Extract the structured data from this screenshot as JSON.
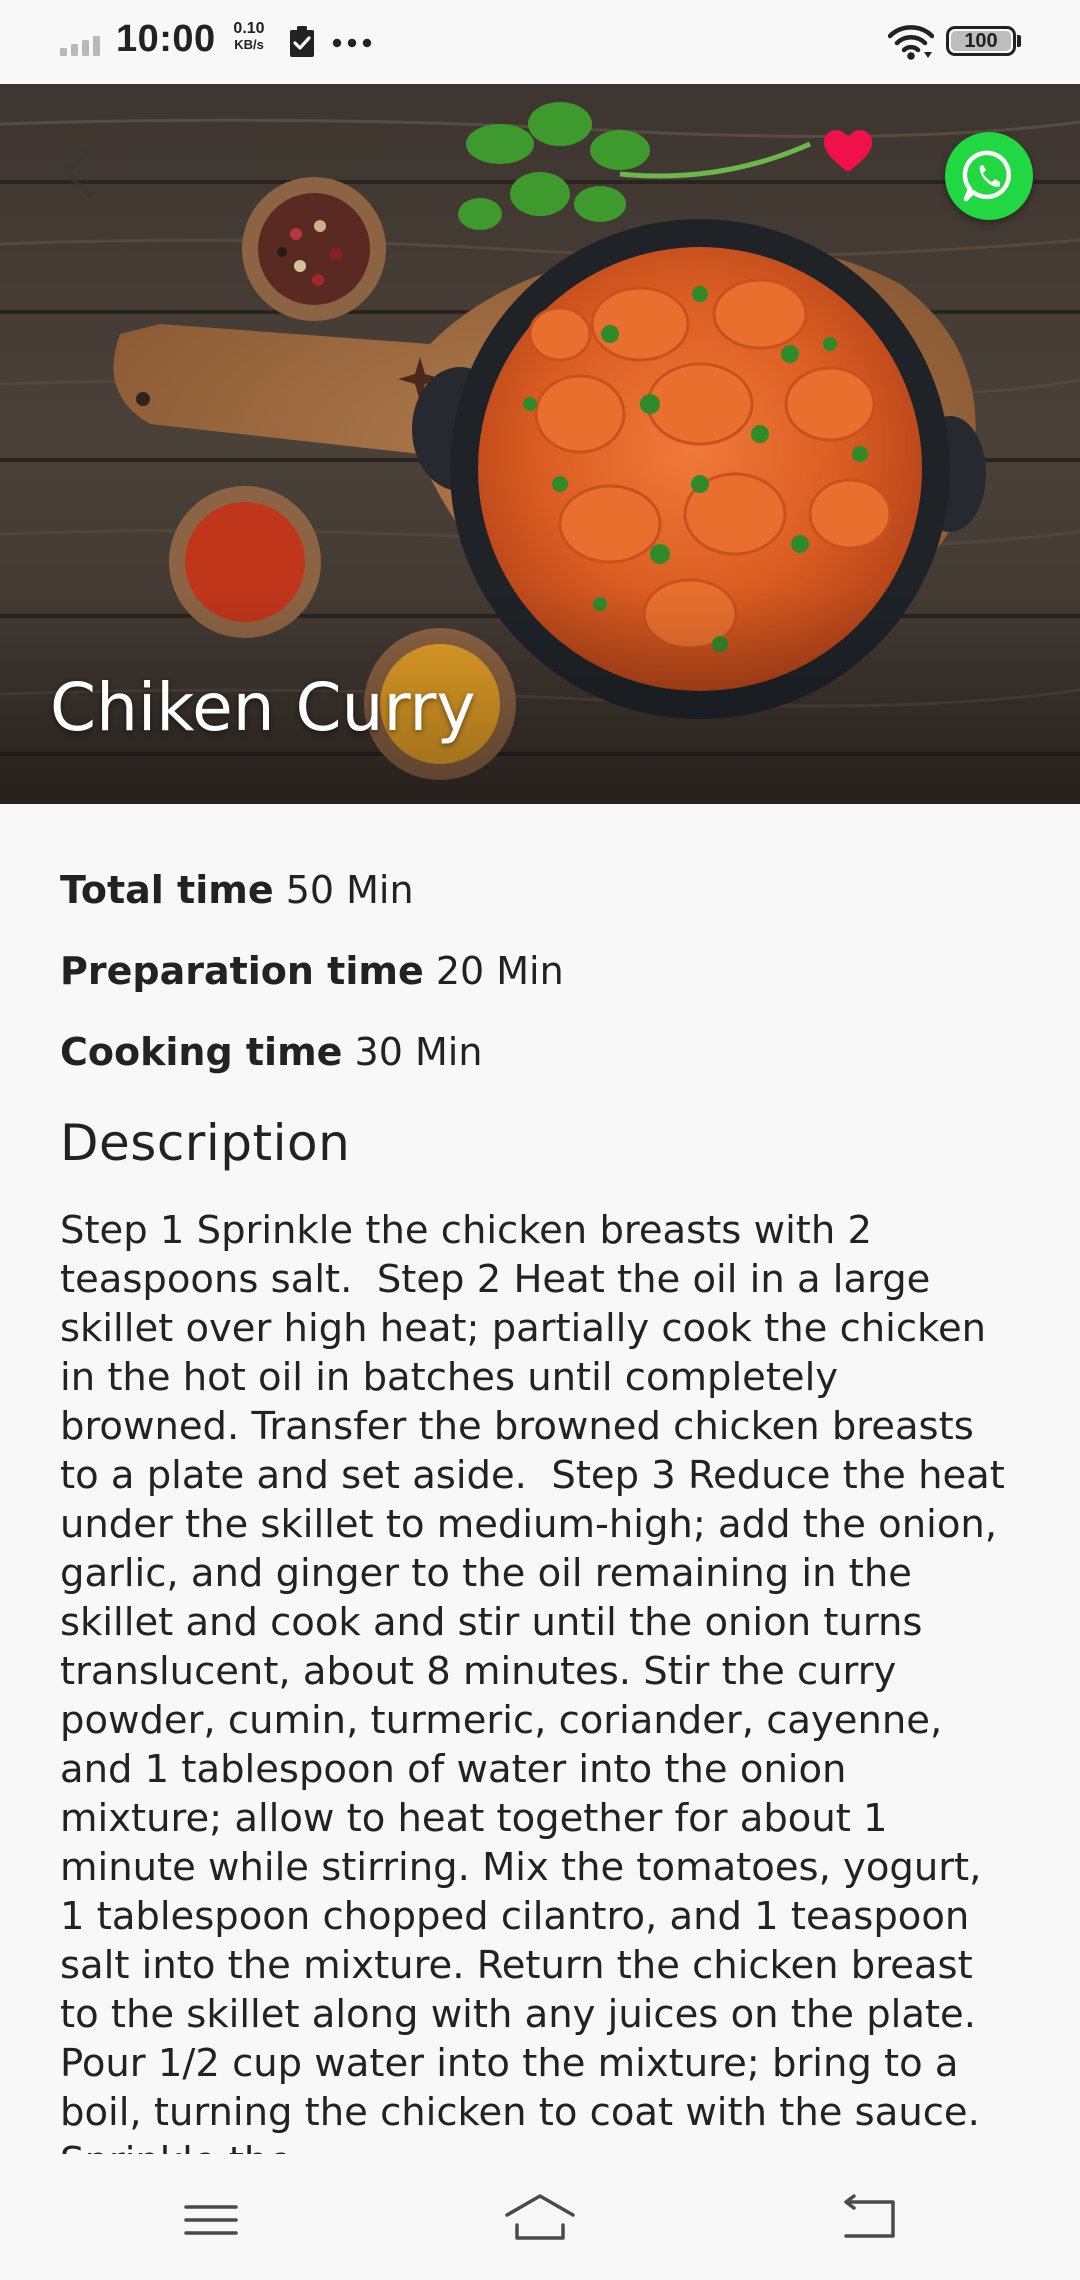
{
  "status_bar": {
    "time": "10:00",
    "net_speed_value": "0.10",
    "net_speed_unit": "KB/s",
    "battery_level": "100",
    "icons": [
      "signal-icon",
      "clipboard-check-icon",
      "more-icon",
      "wifi-icon",
      "battery-icon"
    ]
  },
  "recipe": {
    "title": "Chiken Curry",
    "favorite_color": "#f0104a",
    "share_color": "#21d843",
    "total_time_label": "Total time",
    "total_time_value": "50 Min",
    "preparation_time_label": "Preparation time",
    "preparation_time_value": "20 Min",
    "cooking_time_label": "Cooking time",
    "cooking_time_value": "30 Min",
    "description_heading": "Description",
    "description": "Step 1 Sprinkle the chicken breasts with 2 teaspoons salt.  Step 2 Heat the oil in a large skillet over high heat; partially cook the chicken in the hot oil in batches until completely browned. Transfer the browned chicken breasts to a plate and set aside.  Step 3 Reduce the heat under the skillet to medium-high; add the onion, garlic, and ginger to the oil remaining in the skillet and cook and stir until the onion turns translucent, about 8 minutes. Stir the curry powder, cumin, turmeric, coriander, cayenne, and 1 tablespoon of water into the onion mixture; allow to heat together for about 1 minute while stirring. Mix the tomatoes, yogurt, 1 tablespoon chopped cilantro, and 1 teaspoon salt into the mixture. Return the chicken breast to the skillet along with any juices on the plate. Pour 1/2 cup water into the mixture; bring to a boil, turning the chicken to coat with the sauce. Sprinkle the"
  },
  "nav_bar": {
    "icons": [
      "menu-icon",
      "home-icon",
      "back-icon"
    ]
  }
}
